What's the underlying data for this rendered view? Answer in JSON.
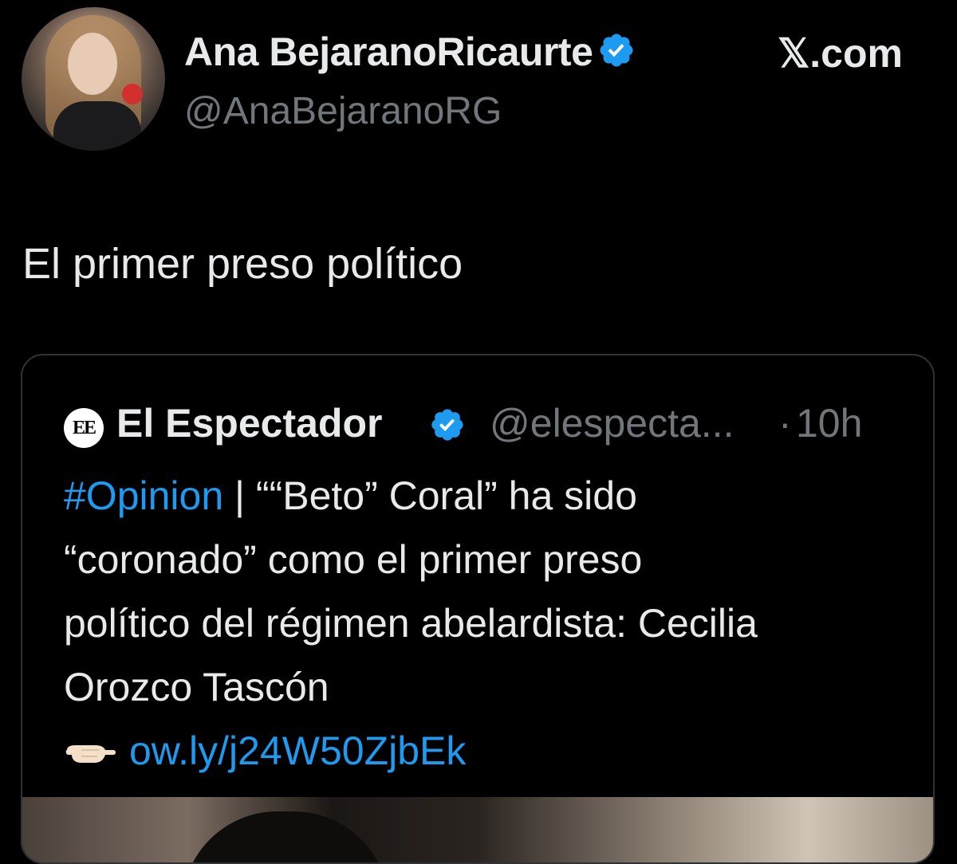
{
  "author": {
    "name": "Ana BejaranoRicaurte",
    "handle": "@AnaBejaranoRG",
    "avatar_icon": "profile-photo"
  },
  "site_label": "𝕏.com",
  "tweet_text": "El primer preso político",
  "quote": {
    "source_name": "El Espectador",
    "logo_text": "EE",
    "handle": "@elespecta...",
    "separator": "·",
    "time": "10h",
    "lines": {
      "l1_hashtag": "#Opinion",
      "l1_rest": " | ““Beto” Coral” ha sido",
      "l2": "“coronado” como el primer preso",
      "l3": "político del régimen abelardista: Cecilia",
      "l4": "Orozco Tascón"
    },
    "pointer_icon": "pointing-left-hand-icon",
    "link": "ow.ly/j24W50ZjbEk"
  },
  "colors": {
    "background": "#000000",
    "text": "#e7e9ea",
    "muted": "#71767b",
    "accent": "#1d9bf0",
    "border": "#2f3336"
  }
}
